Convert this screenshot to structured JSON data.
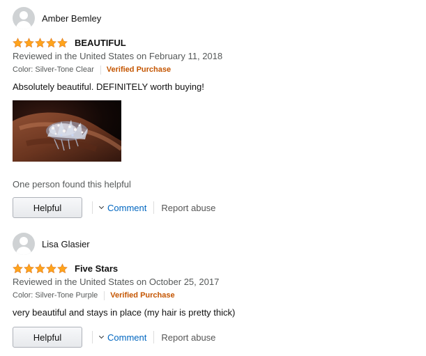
{
  "colors": {
    "star": "#ffa41c",
    "verified": "#c45500",
    "link": "#0066c0",
    "muted": "#565959"
  },
  "reviews": [
    {
      "reviewer": "Amber Bemley",
      "rating": 5,
      "title": "BEAUTIFUL",
      "date": "Reviewed in the United States on February 11, 2018",
      "variant": "Color: Silver-Tone Clear",
      "verified": "Verified Purchase",
      "body": "Absolutely beautiful. DEFINITELY worth buying!",
      "image_icon": "rhinestone-hair-comb-photo",
      "helpful_count": "One person found this helpful",
      "helpful_label": "Helpful",
      "comment_label": "Comment",
      "report_label": "Report abuse"
    },
    {
      "reviewer": "Lisa Glasier",
      "rating": 5,
      "title": "Five Stars",
      "date": "Reviewed in the United States on October 25, 2017",
      "variant": "Color: Silver-Tone Purple",
      "verified": "Verified Purchase",
      "body": "very beautiful and stays in place (my hair is pretty thick)",
      "helpful_label": "Helpful",
      "comment_label": "Comment",
      "report_label": "Report abuse"
    }
  ]
}
